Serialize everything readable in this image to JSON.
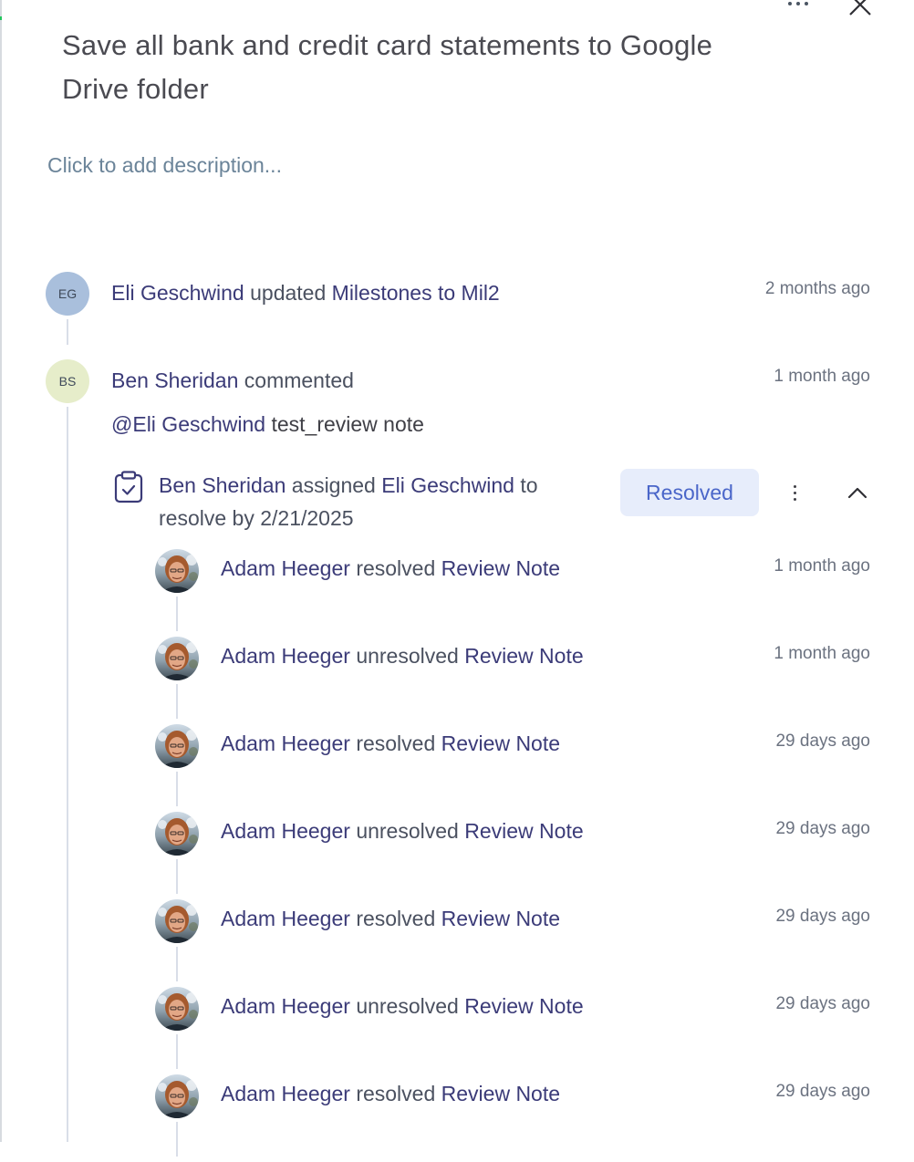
{
  "header": {
    "title": "Save all bank and credit card statements to Google Drive folder",
    "description_placeholder": "Click to add description..."
  },
  "activity": [
    {
      "initials": "EG",
      "user": "Eli Geschwind",
      "action": "updated",
      "target": "Milestones to Mil2",
      "time": "2 months ago",
      "avatar_color": "#a9bfdc"
    },
    {
      "initials": "BS",
      "user": "Ben Sheridan",
      "action": "commented",
      "time": "1 month ago",
      "avatar_color": "#e6edca",
      "comment": {
        "mention": "@Eli Geschwind",
        "text": "test_review note"
      }
    }
  ],
  "review_note": {
    "assigner": "Ben Sheridan",
    "assigned_word": "assigned",
    "assignee": "Eli Geschwind",
    "to_word": "to",
    "resolve_by": "resolve by 2/21/2025",
    "status": "Resolved"
  },
  "history": [
    {
      "user": "Adam Heeger",
      "action": "resolved",
      "target": "Review Note",
      "time": "1 month ago"
    },
    {
      "user": "Adam Heeger",
      "action": "unresolved",
      "target": "Review Note",
      "time": "1 month ago"
    },
    {
      "user": "Adam Heeger",
      "action": "resolved",
      "target": "Review Note",
      "time": "29 days ago"
    },
    {
      "user": "Adam Heeger",
      "action": "unresolved",
      "target": "Review Note",
      "time": "29 days ago"
    },
    {
      "user": "Adam Heeger",
      "action": "resolved",
      "target": "Review Note",
      "time": "29 days ago"
    },
    {
      "user": "Adam Heeger",
      "action": "unresolved",
      "target": "Review Note",
      "time": "29 days ago"
    },
    {
      "user": "Adam Heeger",
      "action": "resolved",
      "target": "Review Note",
      "time": "29 days ago"
    }
  ],
  "icons": {
    "more": "more-horizontal-icon",
    "close": "close-icon",
    "clipboard": "clipboard-check-icon",
    "kebab": "more-vertical-icon",
    "collapse": "chevron-up-icon"
  }
}
